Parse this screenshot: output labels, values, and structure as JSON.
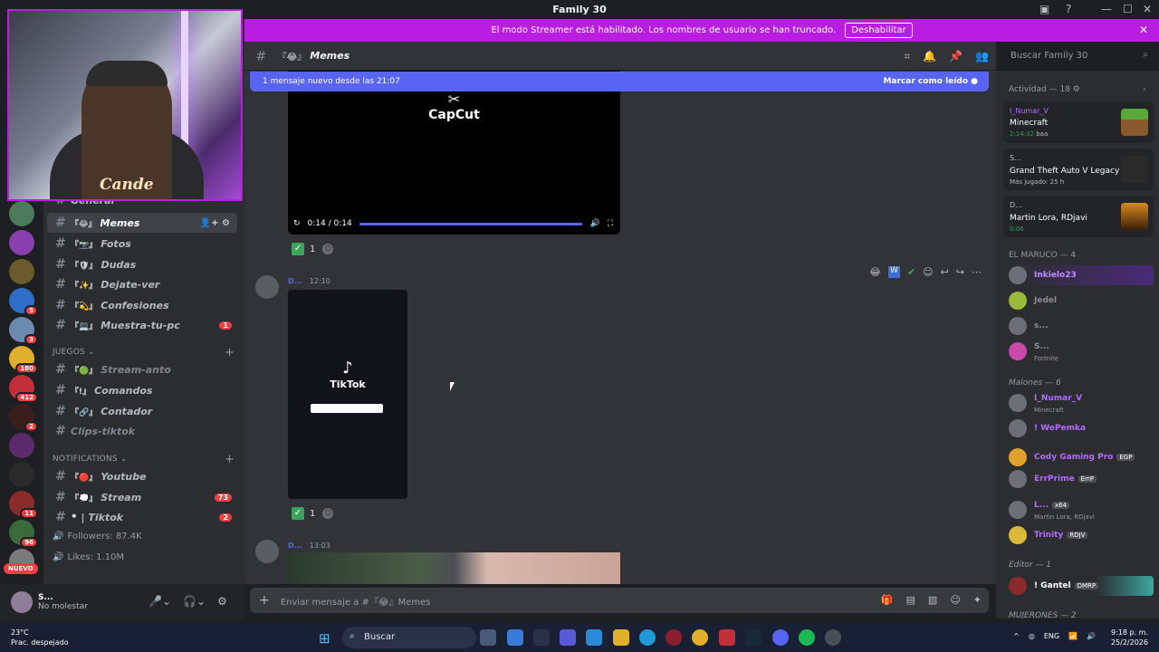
{
  "window": {
    "title": "Family 30"
  },
  "banner": {
    "text": "El modo Streamer está habilitado. Los nombres de usuario se han truncado.",
    "button": "Deshabilitar"
  },
  "channel_header": {
    "emoji": "『😂』",
    "name": "Memes",
    "search_placeholder": "Buscar Family 30"
  },
  "new_messages_bar": {
    "text": "1 mensaje nuevo desde las 21:07",
    "action": "Marcar como leído"
  },
  "sidebar": {
    "partial_channel": "General",
    "channels": [
      {
        "emoji": "『😂』",
        "name": "Memes",
        "active": true
      },
      {
        "emoji": "『📷』",
        "name": "Fotos"
      },
      {
        "emoji": "『🛡』",
        "name": "Dudas"
      },
      {
        "emoji": "『✨』",
        "name": "Dejate-ver"
      },
      {
        "emoji": "『💫』",
        "name": "Confesiones"
      },
      {
        "emoji": "『💻』",
        "name": "Muestra-tu-pc",
        "count": "1"
      }
    ],
    "cat_juegos": "JUEGOS",
    "juegos": [
      {
        "emoji": "『🟢』",
        "name": "Stream-anto",
        "muted": true
      },
      {
        "emoji": "『!』",
        "name": "Comandos"
      },
      {
        "emoji": "『🔗』",
        "name": "Contador"
      },
      {
        "emoji": "",
        "name": "Clips-tiktok",
        "muted": true
      }
    ],
    "cat_notif": "NOTIFICATIONS",
    "notifications": [
      {
        "emoji": "『🔴』",
        "name": "Youtube"
      },
      {
        "emoji": "『💭』",
        "name": "Stream",
        "count": "73"
      },
      {
        "emoji": "⚫",
        "name": "| Tiktok",
        "count": "2"
      }
    ],
    "followers": "Followers: 87.4K",
    "likes": "Likes: 1.10M"
  },
  "server_badges": [
    "5",
    "3",
    "180",
    "412",
    "2",
    "11",
    "96"
  ],
  "nuevo_badge": "NUEVO",
  "webcam_logo": "Cande",
  "user": {
    "name": "S...",
    "status": "No molestar"
  },
  "messages": {
    "video": {
      "brand": "CapCut",
      "time": "0:14 / 0:14",
      "reaction_count": "1"
    },
    "msg2": {
      "author": "D...",
      "time": "12:10",
      "tiktok_brand": "TikTok",
      "reaction_count": "1"
    },
    "msg3": {
      "author": "D...",
      "time": "13:03"
    },
    "composer_placeholder": "Enviar mensaje a #『😂』Memes"
  },
  "members": {
    "activity_header": "Actividad — 18",
    "activities": [
      {
        "user": "I_Numar_V",
        "game": "Minecraft",
        "detail": "2:14:32",
        "detail2": "baa"
      },
      {
        "user": "S...",
        "game": "Grand Theft Auto V Legacy",
        "detail": "Más jugado: 25 h"
      },
      {
        "user": "D...",
        "game": "Martin Lora, RDjavi",
        "detail": "0:06"
      }
    ],
    "group1": "EL MARUCO — 4",
    "group1_members": [
      {
        "name": "Inkielo23",
        "sub": ""
      },
      {
        "name": "Jedel",
        "sub": ""
      },
      {
        "name": "s...",
        "sub": ""
      },
      {
        "name": "S...",
        "sub": "Fortnite"
      }
    ],
    "group2": "Malones — 6",
    "group2_members": [
      {
        "name": "I_Numar_V",
        "sub": "Minecraft"
      },
      {
        "name": "! WePemka",
        "sub": ""
      },
      {
        "name": "Cody Gaming Pro",
        "tag": "EGP",
        "sub": ""
      },
      {
        "name": "ErrPrime",
        "tag": "ErrP",
        "sub": ""
      },
      {
        "name": "L...",
        "tag": "x64",
        "sub": "Martin Lora, RDjavi"
      },
      {
        "name": "Trinity",
        "tag": "RDJV",
        "sub": ""
      }
    ],
    "group3": "Editor — 1",
    "group3_members": [
      {
        "name": "! Gantel",
        "tag": "DMRP"
      }
    ],
    "group4": "MUJERONES — 2"
  },
  "taskbar": {
    "temp": "23°C",
    "weather": "Prac. despejado",
    "search": "Buscar",
    "lang": "ENG",
    "time": "9:18 p. m.",
    "date": "25/2/2026"
  },
  "colors": {
    "accent": "#5865f2",
    "streamer": "#b91de2",
    "danger": "#f23f43",
    "online": "#23a55a"
  }
}
